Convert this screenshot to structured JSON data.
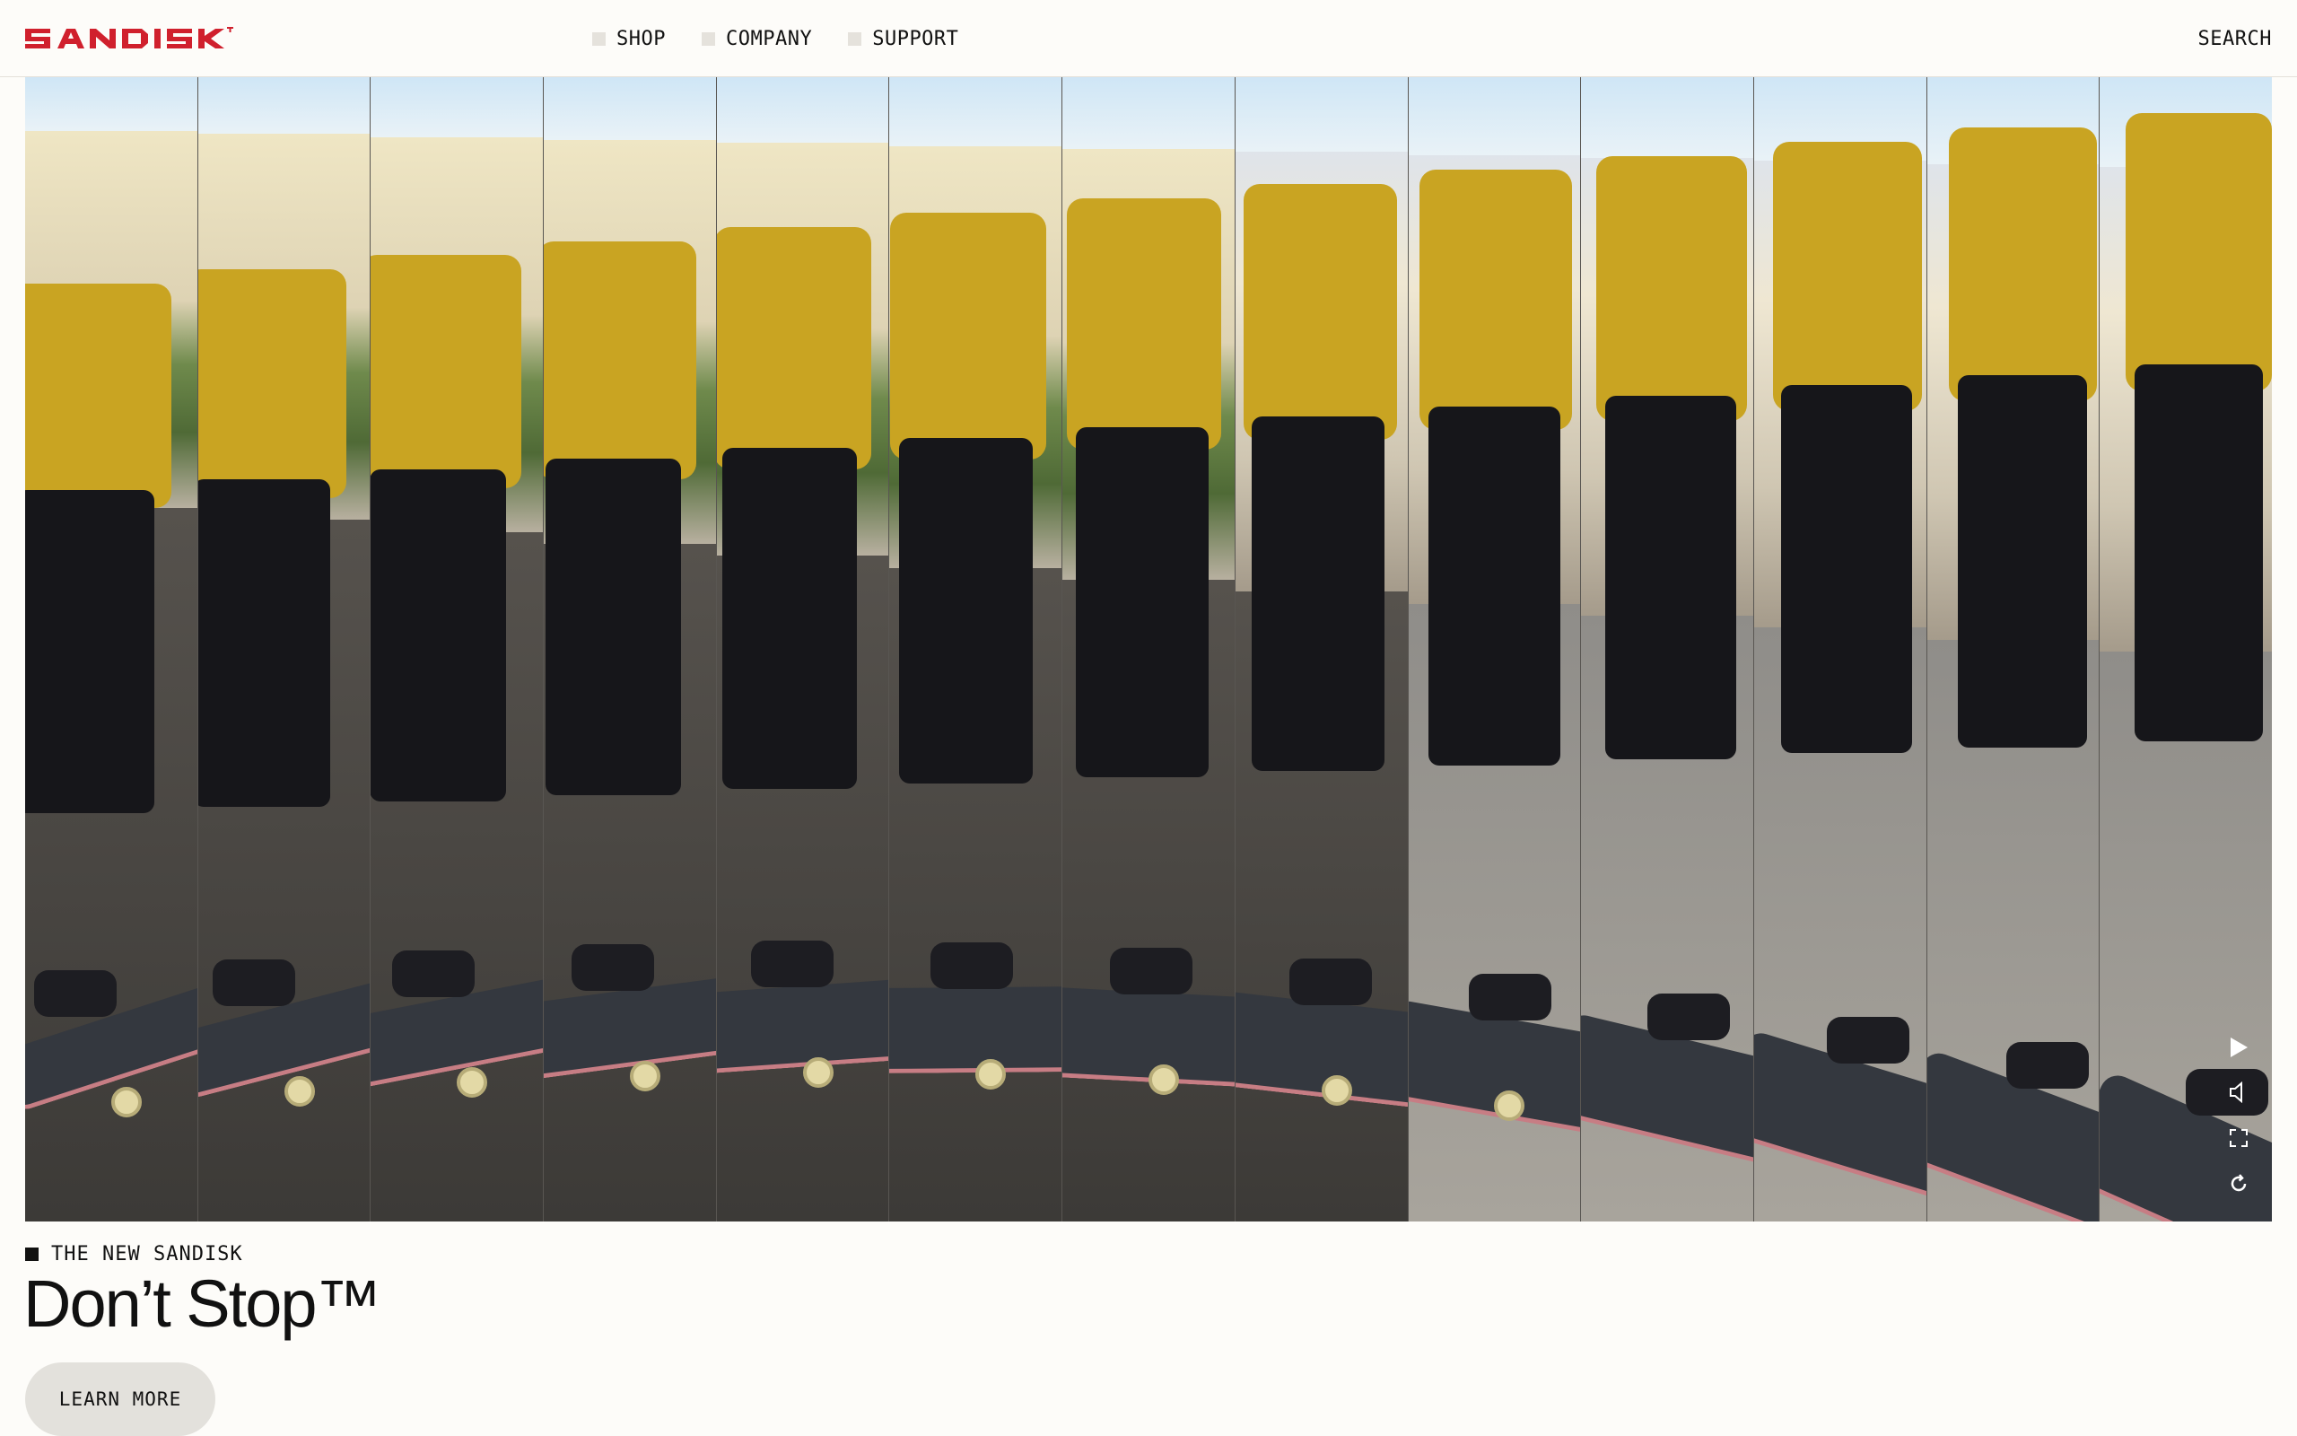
{
  "brand": {
    "logo_text": "SANDISK",
    "logo_color": "#d0202d"
  },
  "nav": {
    "items": [
      {
        "label": "SHOP"
      },
      {
        "label": "COMPANY"
      },
      {
        "label": "SUPPORT"
      }
    ],
    "search_label": "SEARCH"
  },
  "hero": {
    "media": "skateboarder-kickflip-sequence-video",
    "strip_count": 13,
    "controls": [
      "play-icon",
      "mute-icon",
      "fullscreen-icon",
      "replay-icon"
    ]
  },
  "promo": {
    "eyebrow": "THE NEW SANDISK",
    "headline": "Don’t Stop™",
    "cta_label": "LEARN MORE"
  },
  "colors": {
    "background": "#fdfcf9",
    "brand_red": "#d0202d",
    "shirt_yellow": "#c9a422",
    "button_gray": "#e3e1dc"
  }
}
